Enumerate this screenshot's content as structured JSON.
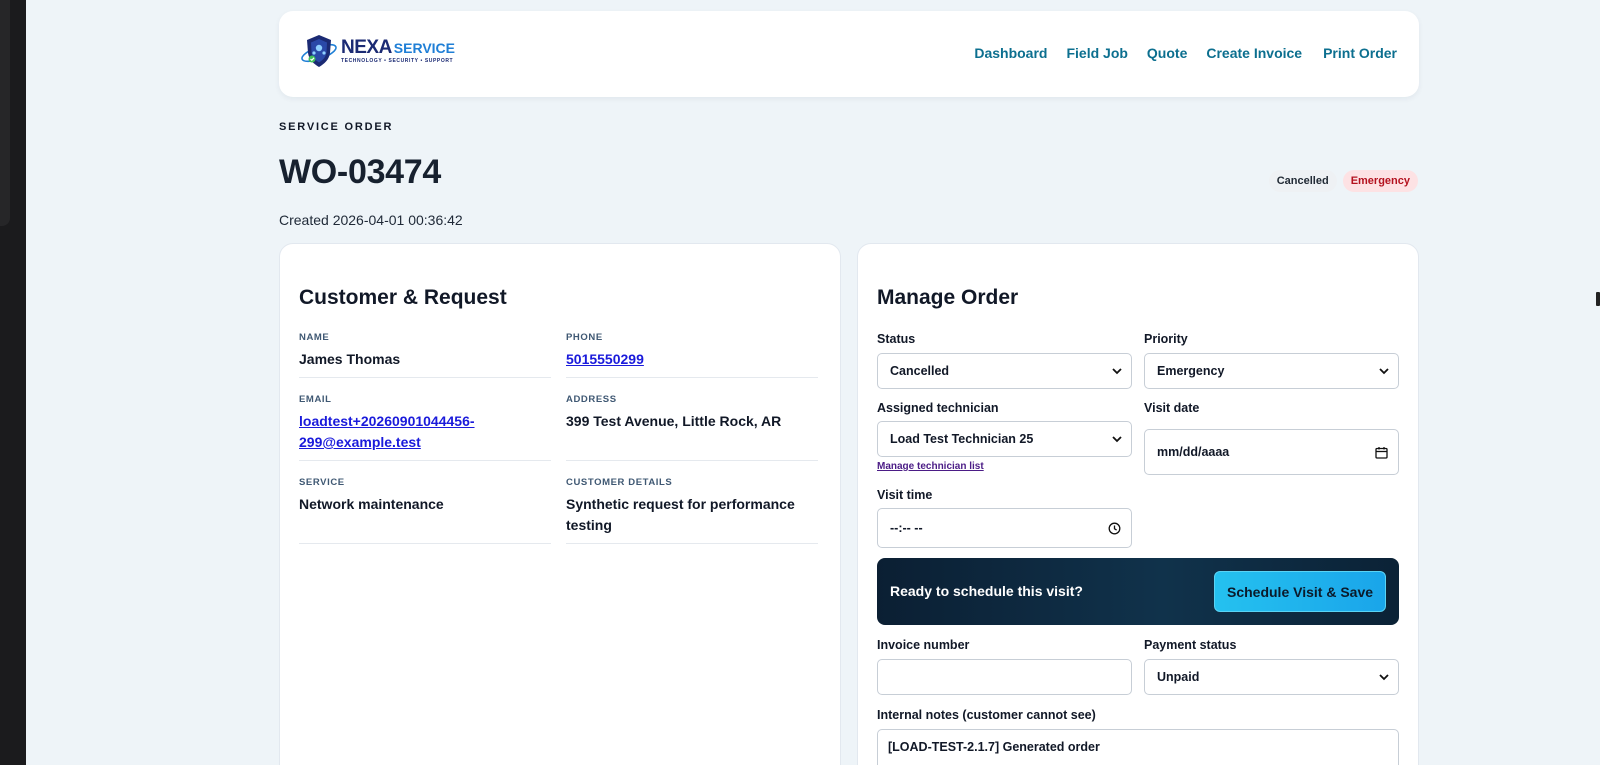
{
  "header": {
    "logo": {
      "name": "NEXA",
      "suffix": "SERVICE",
      "tagline": "TECHNOLOGY • SECURITY • SUPPORT"
    },
    "nav": [
      "Dashboard",
      "Field Job",
      "Quote",
      "Create Invoice",
      "Print Order"
    ]
  },
  "order": {
    "eyebrow": "SERVICE ORDER",
    "id": "WO-03474",
    "created": "Created 2026-04-01 00:36:42",
    "badges": {
      "status": "Cancelled",
      "priority": "Emergency"
    }
  },
  "customer": {
    "title": "Customer & Request",
    "name": {
      "label": "NAME",
      "value": "James Thomas"
    },
    "phone": {
      "label": "PHONE",
      "value": "5015550299"
    },
    "email": {
      "label": "EMAIL",
      "line1": "loadtest+20260901044456-",
      "line2": "299@example.test"
    },
    "address": {
      "label": "ADDRESS",
      "value": "399 Test Avenue, Little Rock, AR"
    },
    "service": {
      "label": "SERVICE",
      "value": "Network maintenance"
    },
    "details": {
      "label": "CUSTOMER DETAILS",
      "line1": "Synthetic request for performance",
      "line2": "testing"
    }
  },
  "manage": {
    "title": "Manage Order",
    "status": {
      "label": "Status",
      "value": "Cancelled"
    },
    "priority": {
      "label": "Priority",
      "value": "Emergency"
    },
    "technician": {
      "label": "Assigned technician",
      "value": "Load Test Technician 25",
      "link": "Manage technician list"
    },
    "visit_date": {
      "label": "Visit date",
      "placeholder": "mm/dd/aaaa"
    },
    "visit_time": {
      "label": "Visit time",
      "placeholder": "--:-- --"
    },
    "schedule": {
      "prompt": "Ready to schedule this visit?",
      "button": "Schedule Visit & Save"
    },
    "invoice": {
      "label": "Invoice number",
      "value": ""
    },
    "payment": {
      "label": "Payment status",
      "value": "Unpaid"
    },
    "notes": {
      "label": "Internal notes (customer cannot see)",
      "value": "[LOAD-TEST-2.1.7] Generated order"
    }
  },
  "colors": {
    "accent_nav": "#0c6f8f",
    "schedule_button": "#1fb6ee",
    "schedule_banner": "#0f2b42",
    "emergency_badge": "#fde2e4",
    "link": "#1a1adb"
  },
  "icons": [
    "shield-logo-icon",
    "chevron-down-icon",
    "calendar-icon",
    "clock-icon"
  ]
}
